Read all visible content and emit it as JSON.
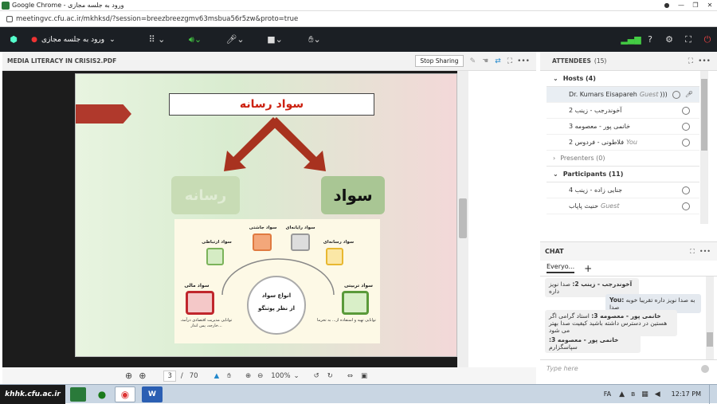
{
  "browser": {
    "title": "Google Chrome - ورود به جلسه مجازی",
    "url": "meetingvc.cfu.ac.ir/mkhksd/?session=breezbreezgmv63msbua56r5zw&proto=true"
  },
  "toolbar": {
    "meeting_label": "ورود به جلسه مجازی"
  },
  "media": {
    "title": "MEDIA LITERACY IN CRISIS2.PDF",
    "stop_sharing": "Stop Sharing"
  },
  "slide": {
    "title": "سواد رسانه",
    "left_box": "رسانه",
    "right_box": "سواد",
    "center_top": "انواع سواد",
    "center_bottom": "از نظر پوتنگو",
    "items": [
      {
        "label": "سواد جاشتی"
      },
      {
        "label": "سواد رایانه‌ای"
      },
      {
        "label": "سواد ارتباطی"
      },
      {
        "label": "سواد رسانه‌ای"
      },
      {
        "label": "سواد مالی"
      },
      {
        "label": "سواد تربیتی"
      }
    ],
    "note_left": "توانایی مدیریت اقتصادی درآمد، خارجه، پس انداز...",
    "note_right": "توانایی تهیه و استفاده از... به تحرما"
  },
  "nav": {
    "page": "3",
    "sep": "/",
    "total": "70",
    "zoom": "100%"
  },
  "attendees": {
    "header": "ATTENDEES",
    "count": "(15)",
    "hosts_label": "Hosts (4)",
    "hosts": [
      {
        "name": "Dr. Kumars Eisapareh",
        "tag": "Guest"
      },
      {
        "name": "آخوندرجب - زینب 2",
        "tag": ""
      },
      {
        "name": "خانمی پور - معصومه 3",
        "tag": ""
      },
      {
        "name": "فلاطونی - فردوس 2",
        "tag": "You"
      }
    ],
    "presenters_label": "Presenters (0)",
    "participants_label": "Participants (11)",
    "participants": [
      {
        "name": "جنایی زاده - زینب 4",
        "tag": ""
      },
      {
        "name": "حنیث پاپاب",
        "tag": "Guest"
      }
    ]
  },
  "chat": {
    "header": "CHAT",
    "tab": "Everyo...",
    "add": "+",
    "messages": [
      {
        "sender": "آخوندرجب - زینب 2:",
        "text": "صدا نویز داره"
      },
      {
        "sender": "You:",
        "text": "به صدا نویز داره تقریبا خوبه صدا"
      },
      {
        "sender": "خانمی پور - معصومه 3:",
        "text": "استاد گرامی اگر هستین در دسترس داشته باشید کیفیت صدا بهتر می شود"
      },
      {
        "sender": "خانمی پور - معصومه 3:",
        "text": "سپاسگزارم"
      }
    ],
    "placeholder": "Type here"
  },
  "taskbar": {
    "brand": "khhk.cfu.ac.ir",
    "lang": "FA",
    "time": "12:17 PM"
  }
}
